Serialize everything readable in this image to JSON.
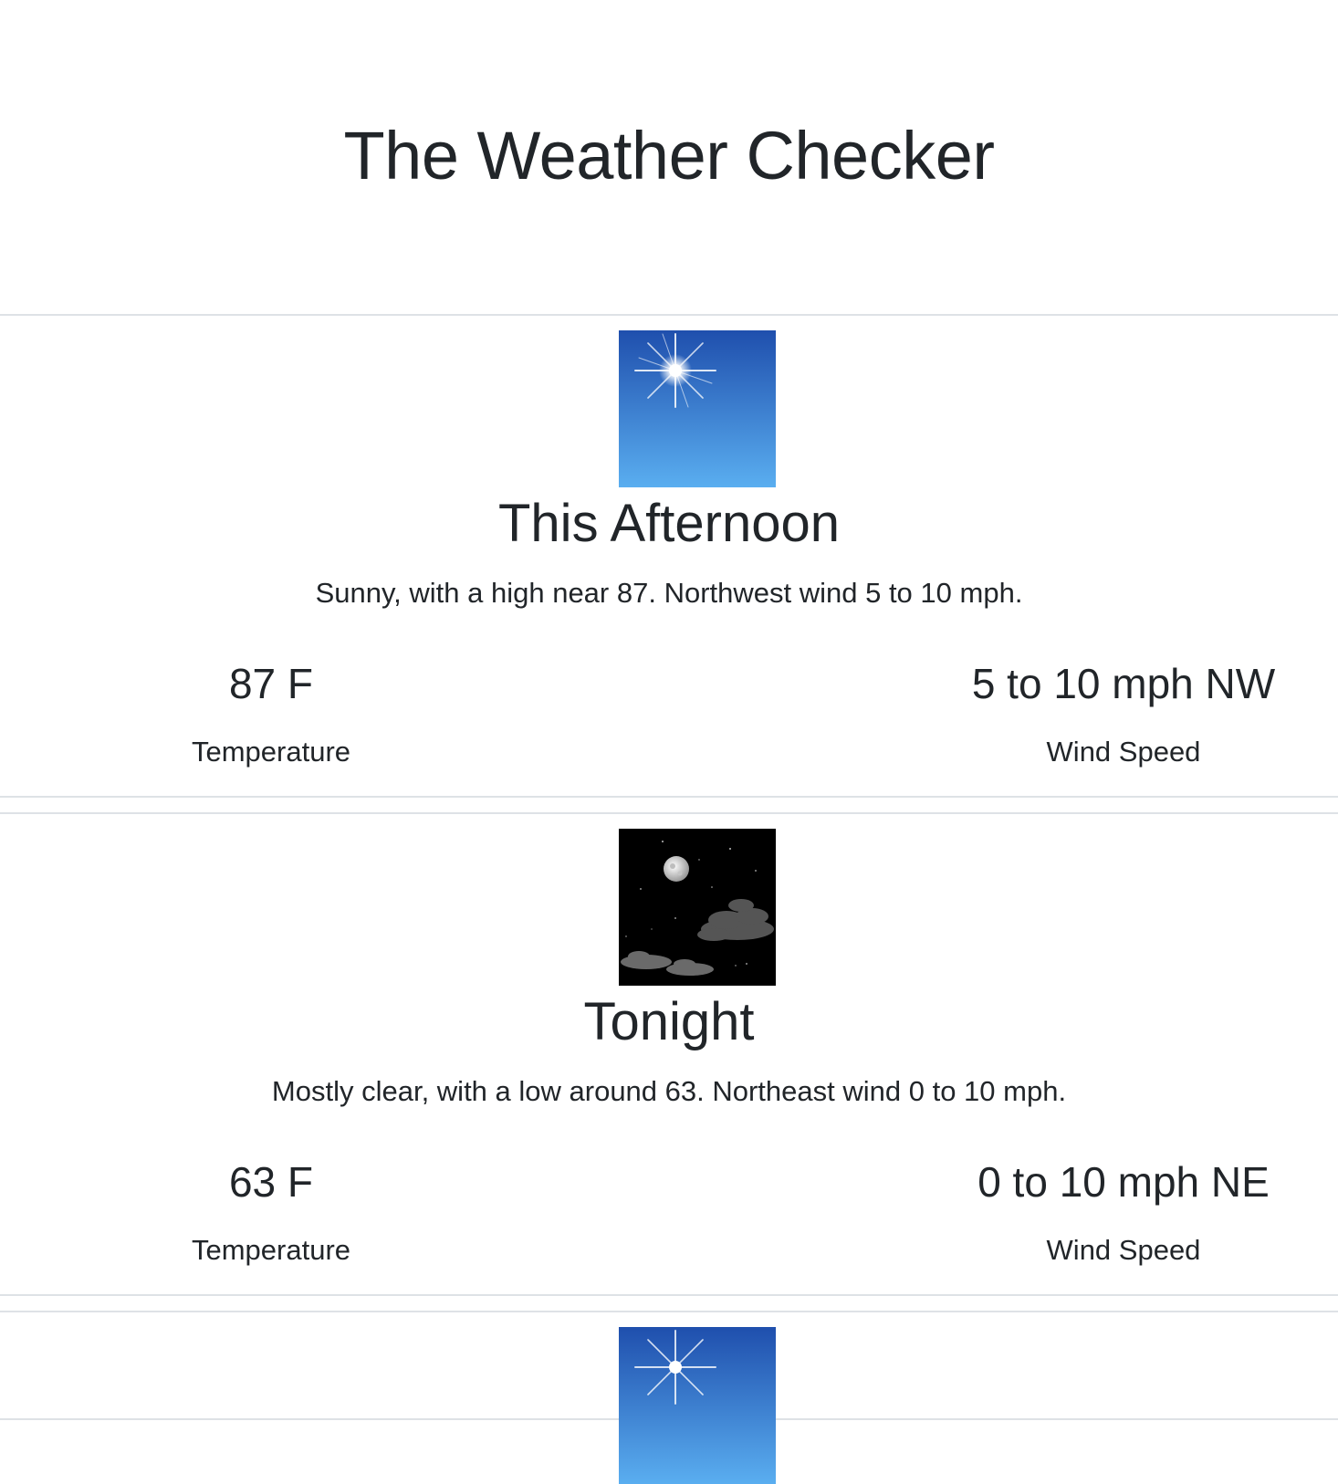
{
  "header": {
    "title": "The Weather Checker"
  },
  "periods": [
    {
      "name": "This Afternoon",
      "icon": "sunny-day-icon",
      "description": "Sunny, with a high near 87. Northwest wind 5 to 10 mph.",
      "temperature": "87 F",
      "temperature_label": "Temperature",
      "wind": "5 to 10 mph NW",
      "wind_label": "Wind Speed"
    },
    {
      "name": "Tonight",
      "icon": "clear-night-icon",
      "description": "Mostly clear, with a low around 63. Northeast wind 0 to 10 mph.",
      "temperature": "63 F",
      "temperature_label": "Temperature",
      "wind": "0 to 10 mph NE",
      "wind_label": "Wind Speed"
    },
    {
      "icon": "sunny-day-icon"
    }
  ],
  "colors": {
    "text": "#212529",
    "divider": "#dee2e6",
    "sky_top": "#1f4fad",
    "sky_bottom": "#5aaef0",
    "night": "#000000"
  }
}
